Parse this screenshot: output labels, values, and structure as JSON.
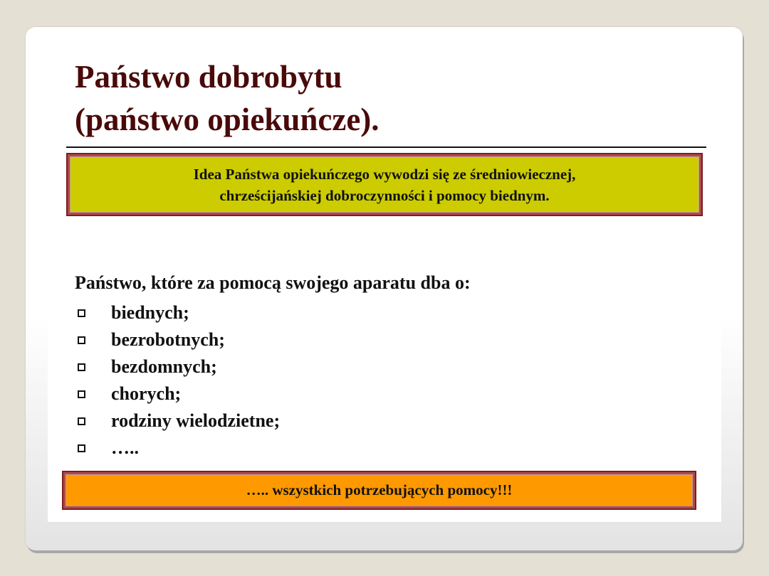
{
  "slide": {
    "title_line1": "Państwo dobrobytu",
    "title_line2": "(państwo opiekuńcze).",
    "idea_box": {
      "line1": "Idea Państwa opiekuńczego wywodzi się ze średniowiecznej,",
      "line2": "chrześcijańskiej dobroczynności i pomocy biednym."
    },
    "intro": "Państwo, które za pomocą swojego aparatu dba o:",
    "list": [
      {
        "label": "biednych;",
        "icon": "square-bullet-icon"
      },
      {
        "label": "bezrobotnych;",
        "icon": "square-bullet-icon"
      },
      {
        "label": "bezdomnych;",
        "icon": "square-bullet-icon"
      },
      {
        "label": "chorych;",
        "icon": "square-bullet-icon"
      },
      {
        "label": "rodziny wielodzietne;",
        "icon": "square-bullet-icon"
      },
      {
        "label": "…..",
        "icon": "square-bullet-icon"
      }
    ],
    "summary_box": "….. wszystkich potrzebujących pomocy!!!"
  },
  "colors": {
    "background": "#e4e0d4",
    "title": "#4a0a0a",
    "idea_box_fill": "#cccc00",
    "summary_box_fill": "#ff9900",
    "box_border": "#7a1f1f"
  }
}
